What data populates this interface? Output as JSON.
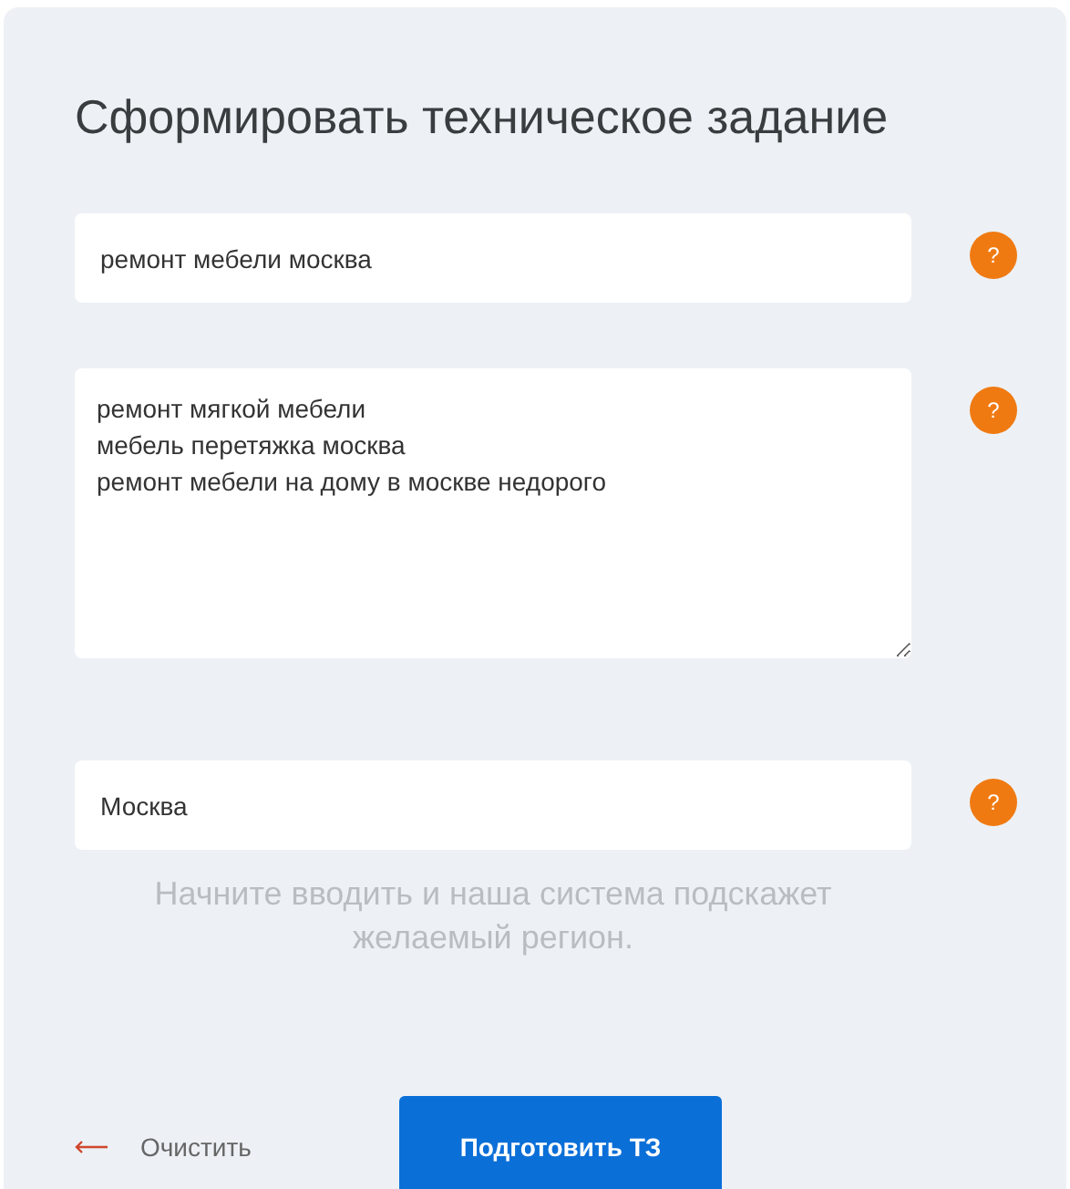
{
  "title": "Сформировать техническое задание",
  "fields": [
    {
      "kind": "input",
      "value": "ремонт мебели москва",
      "help": "?"
    },
    {
      "kind": "textarea",
      "value": "ремонт мягкой мебели\nмебель перетяжка москва\nремонт мебели на дому в москве недорого",
      "help": "?"
    },
    {
      "kind": "input",
      "value": "Москва",
      "help": "?",
      "hint": "Начните вводить и наша система подскажет желаемый регион."
    }
  ],
  "clear_link": "Очистить",
  "submit_button": "Подготовить ТЗ"
}
